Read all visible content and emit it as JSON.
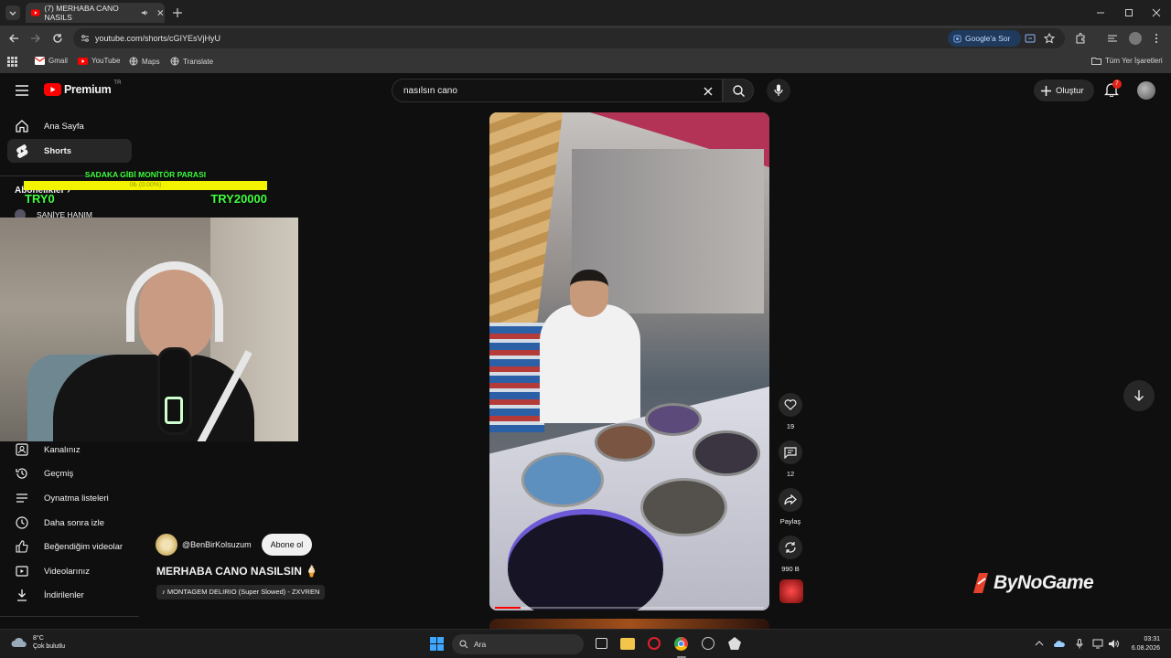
{
  "browser": {
    "tab_title": "(7) MERHABA CANO NASILS",
    "url": "youtube.com/shorts/cGIYEsVjHyU",
    "ask_google": "Google'a Sor",
    "bookmarks": [
      "Gmail",
      "YouTube",
      "Maps",
      "Translate"
    ],
    "all_bookmarks": "Tüm Yer İşaretleri"
  },
  "youtube": {
    "logo_text": "Premium",
    "logo_sup": "TR",
    "search_value": "nasılsın cano",
    "create_label": "Oluştur",
    "notif_count": "7",
    "nav_top": [
      "Ana Sayfa",
      "Shorts"
    ],
    "subs_header": "Abonelikler",
    "sub_partial": "SANİYE HANIM",
    "nav_you": [
      "Kanalınız",
      "Geçmiş",
      "Oynatma listeleri",
      "Daha sonra izle",
      "Beğendiğim videolar",
      "Videolarınız",
      "İndirilenler"
    ]
  },
  "overlay": {
    "donation_title": "SADAKA GİBİ MONİTÖR PARASI",
    "donation_progress": "0₺ (0.00%)",
    "donation_left": "TRY0",
    "donation_right": "TRY20000",
    "watermark": "ByNoGame"
  },
  "short": {
    "channel": "@BenBirKolsuzum",
    "subscribe": "Abone ol",
    "title": "MERHABA CANO NASILSIN 🍦",
    "music": "♪ MONTAGEM DELIRIO (Super Slowed) - ZXVREN",
    "likes": "19",
    "comments": "12",
    "share_label": "Paylaş",
    "remix_count": "990 B"
  },
  "taskbar": {
    "temperature": "8°C",
    "weather": "Çok bulutlu",
    "search": "Ara",
    "time": "03:31",
    "date": "6.08.2026"
  },
  "colors": {
    "yt_red": "#ff0000",
    "bg": "#0f0f0f",
    "donation_bar": "#f3f300",
    "donation_text": "#40ff40",
    "notif": "#e62117"
  }
}
